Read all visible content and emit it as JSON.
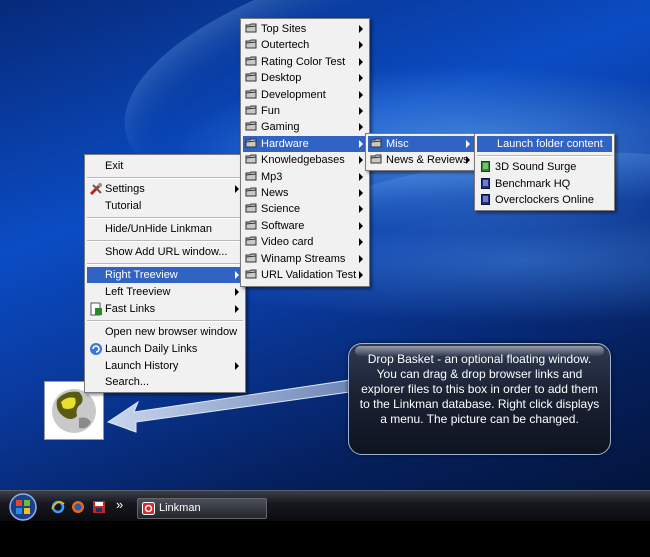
{
  "colors": {
    "menu_bg": "#f1f1f1",
    "highlight": "#3163c5",
    "balloon_bg": "#1b2233",
    "taskbar": "#0a0b0e"
  },
  "linkman_menu": {
    "items": [
      {
        "label": "Exit",
        "icon": "none"
      },
      {
        "label": "Settings",
        "icon": "tools-icon"
      },
      {
        "label": "Tutorial",
        "icon": "none"
      },
      {
        "label": "Hide/UnHide Linkman",
        "icon": "none"
      },
      {
        "label": "Show Add URL window...",
        "icon": "none"
      },
      {
        "label": "Right Treeview",
        "icon": "none"
      },
      {
        "label": "Left Treeview",
        "icon": "none"
      },
      {
        "label": "Fast Links",
        "icon": "fast-links-icon"
      },
      {
        "label": "Open new browser window",
        "icon": "none"
      },
      {
        "label": "Launch Daily Links",
        "icon": "daily-links-icon"
      },
      {
        "label": "Launch History",
        "icon": "none"
      },
      {
        "label": "Search...",
        "icon": "none"
      }
    ]
  },
  "treeview_menu": {
    "items": [
      {
        "label": "Top Sites"
      },
      {
        "label": "Outertech"
      },
      {
        "label": "Rating Color Test"
      },
      {
        "label": "Desktop"
      },
      {
        "label": "Development"
      },
      {
        "label": "Fun"
      },
      {
        "label": "Gaming"
      },
      {
        "label": "Hardware"
      },
      {
        "label": "Knowledgebases"
      },
      {
        "label": "Mp3"
      },
      {
        "label": "News"
      },
      {
        "label": "Science"
      },
      {
        "label": "Software"
      },
      {
        "label": "Video card"
      },
      {
        "label": "Winamp Streams"
      },
      {
        "label": "URL Validation Test"
      }
    ]
  },
  "hardware_menu": {
    "items": [
      {
        "label": "Misc"
      },
      {
        "label": "News & Reviews"
      }
    ]
  },
  "misc_menu": {
    "launch_label": "Launch folder content",
    "items": [
      {
        "label": "3D Sound Surge",
        "icon": "green-doc-icon"
      },
      {
        "label": "Benchmark HQ",
        "icon": "blue-doc-icon"
      },
      {
        "label": "Overclockers Online",
        "icon": "blue-doc-icon"
      }
    ]
  },
  "balloon": {
    "text": "Drop Basket - an optional floating window. You can drag & drop browser links and explorer files to this box in order to add them to the Linkman database. Right click displays a menu. The picture can be changed."
  },
  "taskbar": {
    "overflow": "»",
    "task_label": "Linkman"
  }
}
